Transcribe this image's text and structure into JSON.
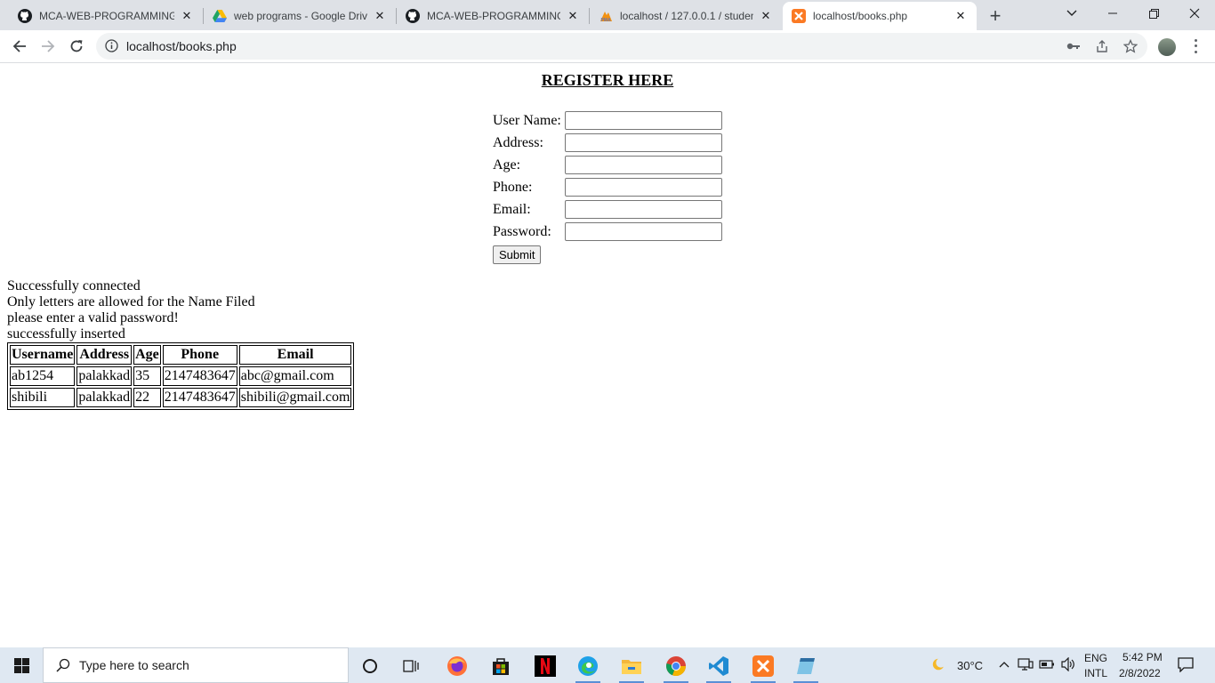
{
  "browser": {
    "tabs": [
      {
        "title": "MCA-WEB-PROGRAMMING/",
        "icon": "github-icon"
      },
      {
        "title": "web programs - Google Drive",
        "icon": "google-drive-icon"
      },
      {
        "title": "MCA-WEB-PROGRAMMING/",
        "icon": "github-icon"
      },
      {
        "title": "localhost / 127.0.0.1 / student",
        "icon": "phpmyadmin-icon"
      },
      {
        "title": "localhost/books.php",
        "icon": "xampp-icon",
        "active": true
      }
    ],
    "address": "localhost/books.php"
  },
  "page": {
    "title": "REGISTER HERE",
    "form": {
      "fields": [
        {
          "label": "User Name:",
          "value": ""
        },
        {
          "label": "Address:",
          "value": ""
        },
        {
          "label": "Age:",
          "value": ""
        },
        {
          "label": "Phone:",
          "value": ""
        },
        {
          "label": "Email:",
          "value": ""
        },
        {
          "label": "Password:",
          "value": ""
        }
      ],
      "submit_label": "Submit"
    },
    "messages": [
      "Successfully connected",
      "Only letters are allowed for the Name Filed",
      "please enter a valid password!",
      "successfully inserted"
    ],
    "table": {
      "headers": [
        "Username",
        "Address",
        "Age",
        "Phone",
        "Email"
      ],
      "rows": [
        [
          "ab1254",
          "palakkad",
          "35",
          "2147483647",
          "abc@gmail.com"
        ],
        [
          "shibili",
          "palakkad",
          "22",
          "2147483647",
          "shibili@gmail.com"
        ]
      ]
    }
  },
  "taskbar": {
    "search_placeholder": "Type here to search",
    "weather": "30°C",
    "language": "ENG",
    "layout": "INTL",
    "time": "5:42 PM",
    "date": "2/8/2022"
  },
  "colors": {
    "tabbar_bg": "#dee1e6",
    "taskbar_bg": "#dfe8f2",
    "accent": "#1a73e8"
  }
}
